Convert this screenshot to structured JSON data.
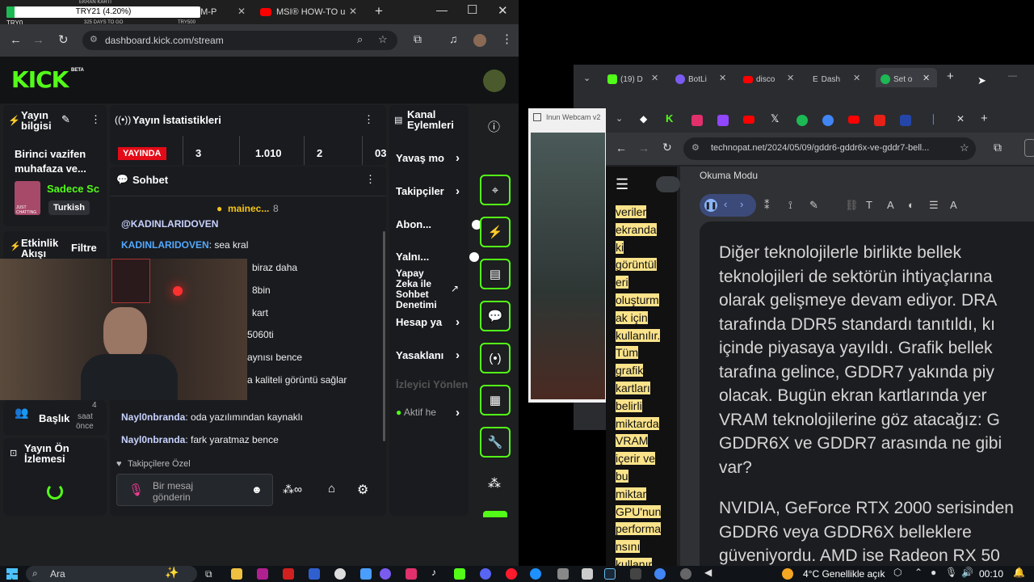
{
  "overlay": {
    "header": "EKRAN KARTI",
    "progress_label": "TRY21 (4.20%)",
    "progress_fraction": 0.042,
    "left_label": "TRY0",
    "mid_label": "325 DAYS TO GO",
    "right_label": "TRY500"
  },
  "left_browser": {
    "tab1_partial": "0M-P",
    "tab2_title": "MSI® HOW-TO u",
    "url": "dashboard.kick.com/stream"
  },
  "kick": {
    "logo": "KICK",
    "beta": "BETA",
    "stream_info": {
      "title": "Yayın bilgisi",
      "stream_title": "Birinci vazifen muhafaza ve...",
      "category": "Sadece Sc",
      "language": "Turkish",
      "thumb_caption": "JUST CHATTING"
    },
    "activity": {
      "title": "Etkinlik Akışı",
      "filter": "Filtre"
    },
    "title_card": {
      "label": "Başlık",
      "time_line1": "4",
      "time_line2": "saat",
      "time_line3": "önce"
    },
    "preview": {
      "title": "Yayın Ön İzlemesi"
    },
    "stats": {
      "title": "Yayın İstatistikleri",
      "live_badge": "YAYINDA",
      "v1": "3",
      "v2": "1.010",
      "v3": "2",
      "v4": "03"
    },
    "chat": {
      "title": "Sohbet",
      "pinned_user": "mainec...",
      "pinned_count": "8",
      "messages": [
        {
          "user": "@KADINLARIDOVEN",
          "text": ""
        },
        {
          "user": "KADINLARIDOVEN",
          "text": "sea kral"
        },
        {
          "user": "",
          "text": "biraz daha"
        },
        {
          "user": "",
          "text": "8bin"
        },
        {
          "user": "",
          "text": "kart"
        },
        {
          "user": "",
          "text": "5060ti"
        },
        {
          "user": "",
          "text": "aynısı bence"
        },
        {
          "user": "",
          "text": "a kaliteli görüntü sağlar"
        },
        {
          "user": "Nayl0nbranda",
          "text": "oda yazılımından kaynaklı"
        },
        {
          "user": "Nayl0nbranda",
          "text": "fark yaratmaz bence"
        }
      ],
      "followers_only": "Takipçilere Özel",
      "input_placeholder": "Bir mesaj gönderin"
    },
    "actions": {
      "title": "Kanal Eylemleri",
      "items": [
        "Yavaş mo",
        "Takipçiler",
        "Abon...",
        "Yalnı...",
        "Yapay Zeka ile Sohbet Denetimi",
        "Hesap ya",
        "Yasaklanı",
        "İzleyici Yönlen",
        "Aktif he"
      ]
    }
  },
  "webcam_window": {
    "title": "Inun Webcam v2"
  },
  "right_browser": {
    "tabs_top": [
      "(19) D",
      "BotLi",
      "disco",
      "Dash",
      "Set o"
    ],
    "url": "technopat.net/2024/05/09/gddr6-gddr6x-ve-gddr7-bell...",
    "reading_mode": "Okuma Modu",
    "narrow_text": [
      "veriler",
      "ekranda",
      "ki",
      "görüntül",
      "eri",
      "oluşturm",
      "ak için",
      "kullanılır.",
      "Tüm",
      "grafik",
      "kartları",
      "belirli",
      "miktarda",
      "VRAM",
      "içerir ve",
      "bu",
      "miktar",
      "GPU'nun",
      "performa",
      "nsını",
      "kullanır"
    ],
    "para1_lines": [
      "Diğer teknolojilerle birlikte bellek",
      "teknolojileri de sektörün ihtiyaçlarına",
      "olarak gelişmeye devam ediyor. DRA",
      "tarafında DDR5 standardı tanıtıldı, kı",
      "içinde piyasaya yayıldı. Grafik bellek",
      "tarafına gelince, GDDR7 yakında piy",
      "olacak. Bugün ekran kartlarında yer",
      "VRAM teknolojilerine göz atacağız: G",
      "GDDR6X ve GDDR7 arasında ne gibi",
      "var?"
    ],
    "para2_lines": [
      "NVIDIA, GeForce RTX 2000 serisinden",
      "GDDR6 veya GDDR6X belleklere",
      "güveniyordu. AMD ise Radeon RX 50"
    ]
  },
  "taskbar": {
    "search": "Ara",
    "weather": "4°C  Genellikle açık",
    "time": "00:10"
  }
}
